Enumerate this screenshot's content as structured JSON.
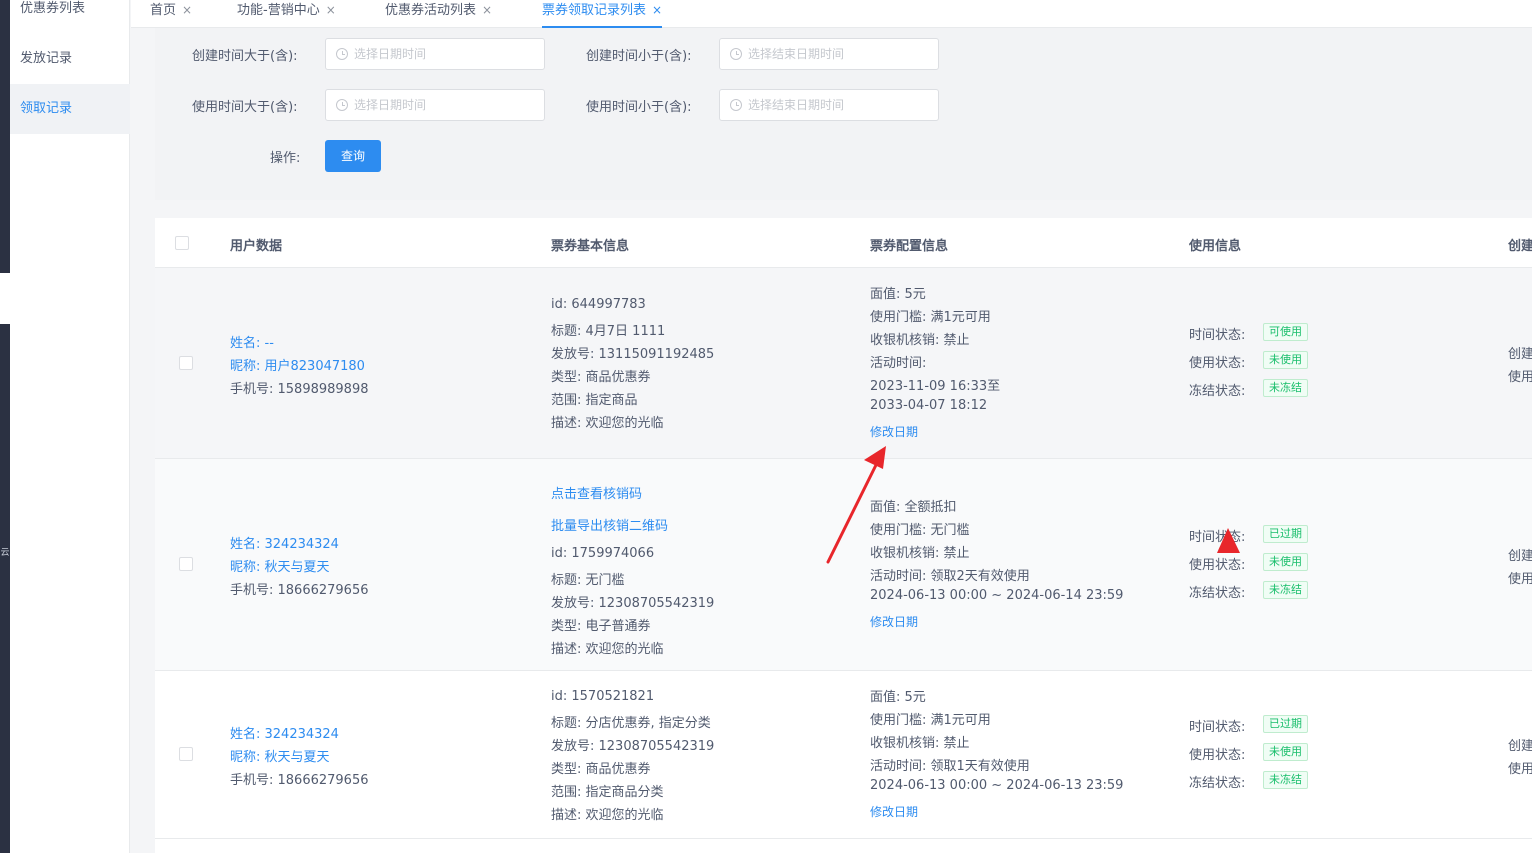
{
  "sidebar": {
    "items": [
      {
        "label": "优惠券列表"
      },
      {
        "label": "发放记录"
      },
      {
        "label": "领取记录"
      }
    ],
    "collapsed_glyph": "云"
  },
  "tabs": [
    {
      "label": "首页"
    },
    {
      "label": "功能-营销中心"
    },
    {
      "label": "优惠券活动列表"
    },
    {
      "label": "票券领取记录列表"
    }
  ],
  "filters": {
    "create_gte_label": "创建时间大于(含):",
    "create_gte_placeholder": "选择日期时间",
    "create_lte_label": "创建时间小于(含):",
    "create_lte_placeholder": "选择结束日期时间",
    "use_gte_label": "使用时间大于(含):",
    "use_gte_placeholder": "选择日期时间",
    "use_lte_label": "使用时间小于(含):",
    "use_lte_placeholder": "选择结束日期时间",
    "action_label": "操作:",
    "query_button": "查询"
  },
  "table": {
    "headers": [
      "用户数据",
      "票券基本信息",
      "票券配置信息",
      "使用信息",
      "创建"
    ],
    "edit_date_label": "修改日期",
    "rows": [
      {
        "user": {
          "name": "姓名: --",
          "nickname": "昵称: 用户823047180",
          "phone": "手机号: 15898989898"
        },
        "basic": [
          "id: 644997783",
          "标题: 4月7日 1111",
          "发放号: 13115091192485",
          "类型: 商品优惠券",
          "范围: 指定商品",
          "描述: 欢迎您的光临"
        ],
        "config": [
          "面值: 5元",
          "使用门槛: 满1元可用",
          "收银机核销: 禁止",
          "活动时间:",
          "2023-11-09 16:33至",
          "2033-04-07 18:12"
        ],
        "usage": [
          {
            "label": "时间状态:",
            "badge": "可使用"
          },
          {
            "label": "使用状态:",
            "badge": "未使用"
          },
          {
            "label": "冻结状态:",
            "badge": "未冻结"
          }
        ],
        "create": [
          "创建",
          "使用"
        ]
      },
      {
        "links": [
          "点击查看核销码",
          "批量导出核销二维码"
        ],
        "user": {
          "name": "姓名: 324234324",
          "nickname": "昵称: 秋天与夏天",
          "phone": "手机号: 18666279656"
        },
        "basic": [
          "id: 1759974066",
          "标题: 无门槛",
          "发放号: 12308705542319",
          "类型: 电子普通券",
          "描述: 欢迎您的光临"
        ],
        "config": [
          "面值: 全额抵扣",
          "使用门槛: 无门槛",
          "收银机核销: 禁止",
          "活动时间: 领取2天有效使用",
          "2024-06-13 00:00 ~ 2024-06-14 23:59"
        ],
        "usage": [
          {
            "label": "时间状态:",
            "badge": "已过期"
          },
          {
            "label": "使用状态:",
            "badge": "未使用"
          },
          {
            "label": "冻结状态:",
            "badge": "未冻结"
          }
        ],
        "create": [
          "创建",
          "使用"
        ]
      },
      {
        "user": {
          "name": "姓名: 324234324",
          "nickname": "昵称: 秋天与夏天",
          "phone": "手机号: 18666279656"
        },
        "basic": [
          "id: 1570521821",
          "标题: 分店优惠券, 指定分类",
          "发放号: 12308705542319",
          "类型: 商品优惠券",
          "范围: 指定商品分类",
          "描述: 欢迎您的光临"
        ],
        "config": [
          "面值: 5元",
          "使用门槛: 满1元可用",
          "收银机核销: 禁止",
          "活动时间: 领取1天有效使用",
          "2024-06-13 00:00 ~ 2024-06-13 23:59"
        ],
        "usage": [
          {
            "label": "时间状态:",
            "badge": "已过期"
          },
          {
            "label": "使用状态:",
            "badge": "未使用"
          },
          {
            "label": "冻结状态:",
            "badge": "未冻结"
          }
        ],
        "create": [
          "创建",
          "使用"
        ]
      }
    ]
  },
  "colors": {
    "accent": "#2d8cf0",
    "badge_text": "#19be6b",
    "annotation_arrow": "#e8262b"
  }
}
